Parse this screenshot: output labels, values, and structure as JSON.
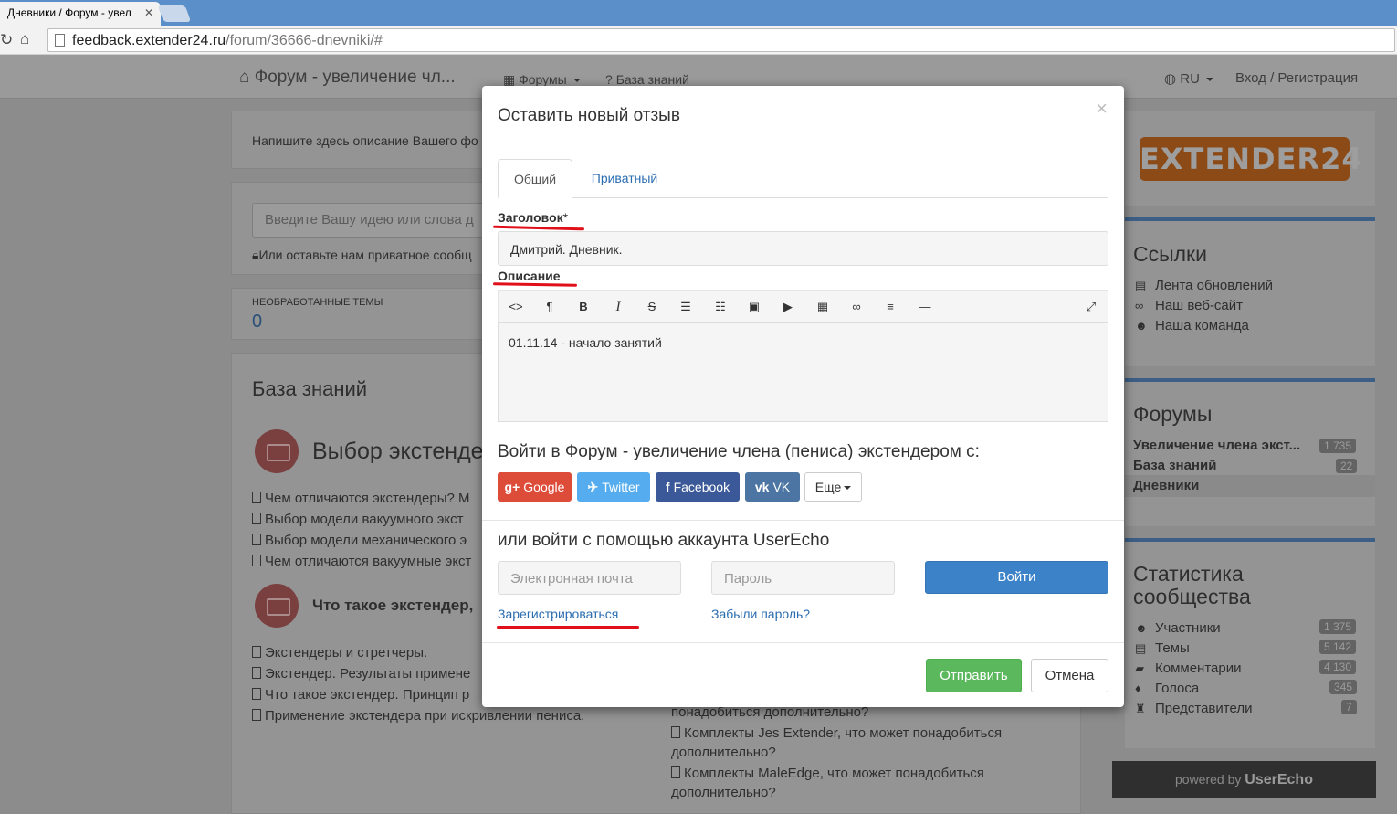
{
  "browser": {
    "tab_title": "Дневники / Форум - увел",
    "url_host": "feedback.extender24.ru",
    "url_path": "/forum/36666-dnevniki/#"
  },
  "navbar": {
    "brand": "Форум - увеличение чл...",
    "forums": "Форумы",
    "knowledge": "База знаний",
    "lang": "RU",
    "login": "Вход / Регистрация"
  },
  "page": {
    "description": "Напишите здесь описание Вашего фо",
    "idea_placeholder": "Введите Вашу идею или слова д",
    "private_msg": "Или оставьте нам приватное сообщ",
    "unprocessed_label": "НЕОБРАБОТАННЫЕ ТЕМЫ",
    "unprocessed_count": "0",
    "kb_title": "База знаний",
    "section1_title": "Выбор экстенде",
    "section1_items": [
      "Чем отличаются экстендеры? М",
      "Выбор модели вакуумного экст",
      "Выбор модели механического э",
      "Чем отличаются вакуумные экст"
    ],
    "section2_title": "Что такое экстендер,",
    "section2_items": [
      "Экстендеры и стретчеры.",
      "Экстендер. Результаты примене",
      "Что такое экстендер. Принцип р",
      "Применение экстендера при искривлении пениса."
    ],
    "right_col": [
      "понадобиться дополнительно?",
      "Комплекты Jes Extender, что может понадобиться",
      "дополнительно?",
      "Комплекты MaleEdge, что может понадобиться",
      "дополнительно?"
    ]
  },
  "sidebar": {
    "logo": "EXTENDER24",
    "links_title": "Ссылки",
    "links": [
      "Лента обновлений",
      "Наш веб-сайт",
      "Наша команда"
    ],
    "forums_title": "Форумы",
    "forums": [
      {
        "name": "Увеличение члена экст...",
        "count": "1 735"
      },
      {
        "name": "База знаний",
        "count": "22"
      },
      {
        "name": "Дневники",
        "count": ""
      }
    ],
    "stats_title_1": "Статистика",
    "stats_title_2": "сообщества",
    "stats": [
      {
        "name": "Участники",
        "count": "1 375"
      },
      {
        "name": "Темы",
        "count": "5 142"
      },
      {
        "name": "Комментарии",
        "count": "4 130"
      },
      {
        "name": "Голоса",
        "count": "345"
      },
      {
        "name": "Представители",
        "count": "7"
      }
    ],
    "powered_by": "powered by",
    "powered_brand": "UserEcho"
  },
  "modal": {
    "title": "Оставить новый отзыв",
    "close": "×",
    "tab_general": "Общий",
    "tab_private": "Приватный",
    "label_title": "Заголовок",
    "required_mark": "*",
    "title_value": "Дмитрий. Дневник.",
    "label_description": "Описание",
    "description_value": "01.11.14 - начало занятий",
    "social_heading": "Войти в Форум - увеличение члена (пениса) экстендером с:",
    "btn_google": "Google",
    "btn_twitter": "Twitter",
    "btn_facebook": "Facebook",
    "btn_vk": "VK",
    "btn_more": "Еще",
    "account_heading": "или войти с помощью аккаунта UserEcho",
    "email_placeholder": "Электронная почта",
    "password_placeholder": "Пароль",
    "btn_login": "Войти",
    "link_register": "Зарегистрироваться",
    "link_forgot": "Забыли пароль?",
    "btn_send": "Отправить",
    "btn_cancel": "Отмена"
  },
  "colors": {
    "google": "#dd4b39",
    "twitter": "#55acee",
    "facebook": "#3b5998",
    "vk": "#4c75a3",
    "primary": "#3c82c8",
    "success": "#5cb85c",
    "annotation": "#e0101a"
  }
}
